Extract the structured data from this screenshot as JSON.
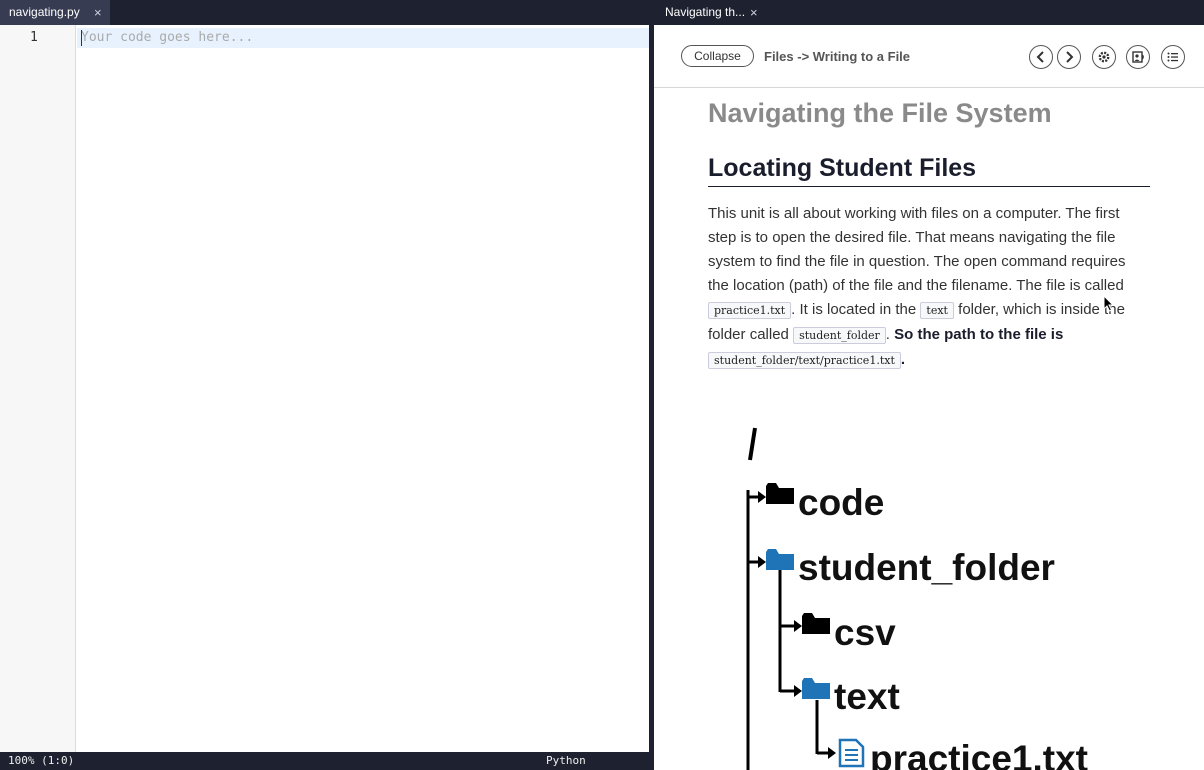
{
  "editor": {
    "tab_label": "navigating.py",
    "close_glyph": "×",
    "line_number": "1",
    "placeholder": "Your code goes here...",
    "status_zoom": "100% (1:0)",
    "status_language": "Python"
  },
  "guide": {
    "tab_label": "Navigating th...",
    "close_glyph": "×",
    "collapse_label": "Collapse",
    "breadcrumb": "Files -> Writing to a File",
    "icons": [
      "chevron-left-icon",
      "chevron-right-icon",
      "gear-icon",
      "read-aloud-icon",
      "list-icon"
    ],
    "page_title": "Navigating the File System",
    "section_title": "Locating Student Files",
    "paragraph": {
      "p1": "This unit is all about working with files on a computer. The first step is to open the desired file. That means navigating the file system to find the file in question. The open command requires the location (path) of the file and the filename. The file is called ",
      "code1": "practice1.txt",
      "p2": ". It is located in the ",
      "code2": "text",
      "p3": " folder, which is inside the folder called ",
      "code3": "student_folder",
      "p4": ". ",
      "bold1": "So the path to the file is ",
      "code4": "student_folder/text/practice1.txt",
      "bold2": "."
    },
    "tree": {
      "root": "/",
      "items": [
        "code",
        "student_folder",
        "csv",
        "text",
        "practice1.txt"
      ]
    }
  },
  "colors": {
    "chrome": "#1e2130",
    "active_tab": "#373c52",
    "folder_black": "#000000",
    "folder_blue": "#1f73b7",
    "file_blue": "#1f73b7"
  }
}
